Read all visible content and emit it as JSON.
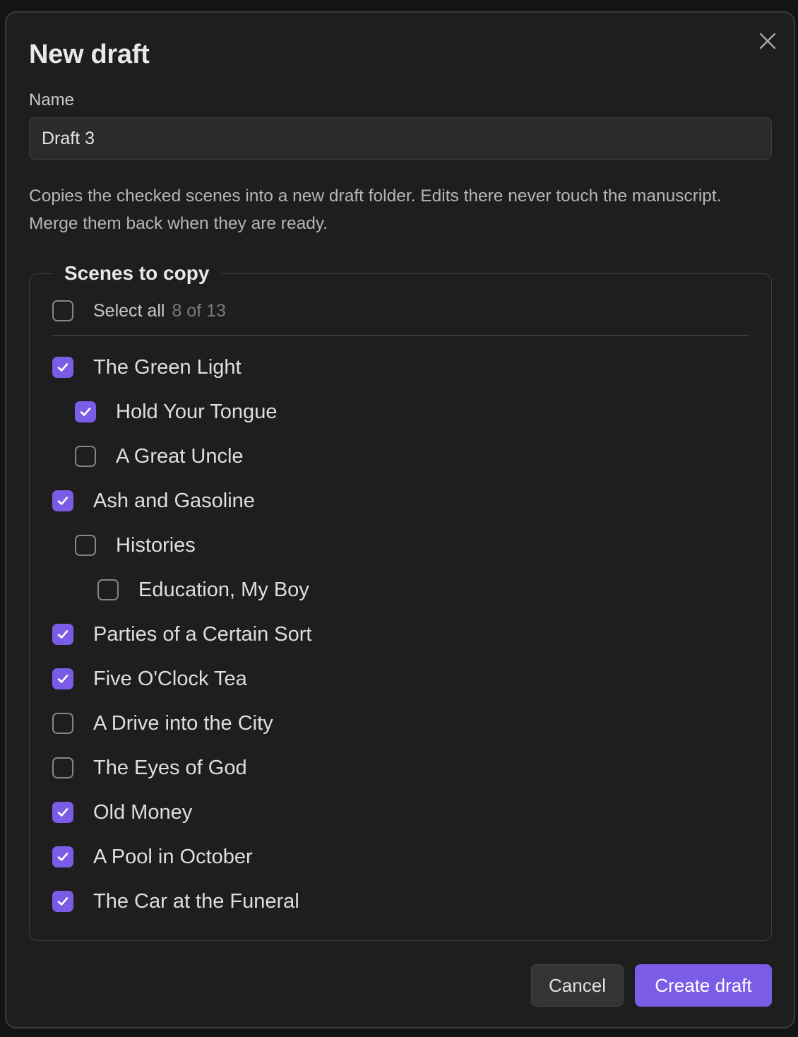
{
  "dialog": {
    "title": "New draft",
    "name_label": "Name",
    "name_value": "Draft 3",
    "description": "Copies the checked scenes into a new draft folder. Edits there never touch the manuscript. Merge them back when they are ready.",
    "scenes_legend": "Scenes to copy",
    "select_all": {
      "label": "Select all",
      "count": "8 of 13",
      "checked": false
    },
    "scenes": [
      {
        "label": "The Green Light",
        "checked": true,
        "level": 0
      },
      {
        "label": "Hold Your Tongue",
        "checked": true,
        "level": 1
      },
      {
        "label": "A Great Uncle",
        "checked": false,
        "level": 1
      },
      {
        "label": "Ash and Gasoline",
        "checked": true,
        "level": 0
      },
      {
        "label": "Histories",
        "checked": false,
        "level": 1
      },
      {
        "label": "Education, My Boy",
        "checked": false,
        "level": 2
      },
      {
        "label": "Parties of a Certain Sort",
        "checked": true,
        "level": 0
      },
      {
        "label": "Five O'Clock Tea",
        "checked": true,
        "level": 0
      },
      {
        "label": "A Drive into the City",
        "checked": false,
        "level": 0
      },
      {
        "label": "The Eyes of God",
        "checked": false,
        "level": 0
      },
      {
        "label": "Old Money",
        "checked": true,
        "level": 0
      },
      {
        "label": "A Pool in October",
        "checked": true,
        "level": 0
      },
      {
        "label": "The Car at the Funeral",
        "checked": true,
        "level": 0
      }
    ],
    "buttons": {
      "cancel": "Cancel",
      "create": "Create draft"
    },
    "icons": {
      "close": "close-icon",
      "check": "check-icon"
    },
    "colors": {
      "accent": "#7b5ce6",
      "background": "#1e1e1e"
    }
  }
}
